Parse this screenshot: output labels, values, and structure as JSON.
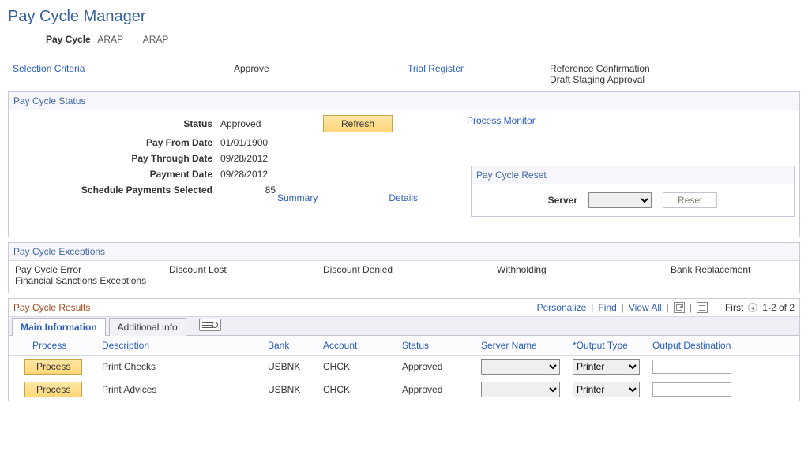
{
  "page": {
    "title": "Pay Cycle Manager"
  },
  "paycycle": {
    "label": "Pay Cycle",
    "code": "ARAP",
    "desc": "ARAP"
  },
  "nav": {
    "selection_criteria": "Selection Criteria",
    "approve": "Approve",
    "trial_register": "Trial Register",
    "reference_confirmation": "Reference Confirmation",
    "draft_staging_approval": "Draft Staging Approval"
  },
  "status_section": {
    "title": "Pay Cycle Status",
    "labels": {
      "status": "Status",
      "pay_from_date": "Pay From Date",
      "pay_through_date": "Pay Through Date",
      "payment_date": "Payment Date",
      "sched_payments_selected": "Schedule Payments Selected"
    },
    "values": {
      "status": "Approved",
      "pay_from_date": "01/01/1900",
      "pay_through_date": "09/28/2012",
      "payment_date": "09/28/2012",
      "sched_payments_selected": "85"
    },
    "refresh_label": "Refresh",
    "process_monitor": "Process Monitor",
    "summary": "Summary",
    "details": "Details"
  },
  "reset_box": {
    "title": "Pay Cycle Reset",
    "server_label": "Server",
    "server_value": "",
    "reset_label": "Reset"
  },
  "exceptions": {
    "title": "Pay Cycle Exceptions",
    "items": {
      "pay_cycle_error": "Pay Cycle Error",
      "discount_lost": "Discount Lost",
      "discount_denied": "Discount Denied",
      "withholding": "Withholding",
      "bank_replacement": "Bank Replacement",
      "financial_sanctions": "Financial Sanctions Exceptions"
    }
  },
  "results": {
    "title": "Pay Cycle Results",
    "toolbar": {
      "personalize": "Personalize",
      "find": "Find",
      "view_all": "View All",
      "first": "First",
      "range": "1-2 of 2"
    },
    "tabs": {
      "main": "Main Information",
      "additional": "Additional Info"
    },
    "headers": {
      "process": "Process",
      "description": "Description",
      "bank": "Bank",
      "account": "Account",
      "status": "Status",
      "server_name": "Server Name",
      "output_type": "*Output Type",
      "output_destination": "Output Destination"
    },
    "process_button_label": "Process",
    "rows": [
      {
        "description": "Print Checks",
        "bank": "USBNK",
        "account": "CHCK",
        "status": "Approved",
        "server_name": "",
        "output_type": "Printer",
        "output_destination": ""
      },
      {
        "description": "Print Advices",
        "bank": "USBNK",
        "account": "CHCK",
        "status": "Approved",
        "server_name": "",
        "output_type": "Printer",
        "output_destination": ""
      }
    ]
  }
}
